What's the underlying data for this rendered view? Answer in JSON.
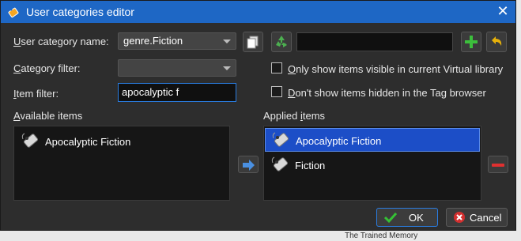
{
  "window": {
    "title": "User categories editor",
    "close_glyph": "✕"
  },
  "labels": {
    "category_name": {
      "pre": "",
      "key": "U",
      "post": "ser category name:"
    },
    "category_filter": {
      "pre": "",
      "key": "C",
      "post": "ategory filter:"
    },
    "item_filter": {
      "pre": "",
      "key": "I",
      "post": "tem filter:"
    },
    "available": {
      "pre": "",
      "key": "A",
      "post": "vailable items"
    },
    "applied": {
      "pre": "Applied ",
      "key": "i",
      "post": "tems"
    }
  },
  "fields": {
    "category_name_value": "genre.Fiction",
    "category_filter_value": "",
    "item_filter_value": "apocalyptic f",
    "new_category_value": ""
  },
  "checks": {
    "only_visible": {
      "pre": "",
      "key": "O",
      "post": "nly show items visible in current Virtual library",
      "checked": false
    },
    "dont_show_hidden": {
      "pre": "",
      "key": "D",
      "post": "on't show items hidden in the Tag browser",
      "checked": false
    }
  },
  "available_items": [
    {
      "label": "Apocalyptic Fiction"
    }
  ],
  "applied_items": [
    {
      "label": "Apocalyptic Fiction",
      "selected": true
    },
    {
      "label": "Fiction",
      "selected": false
    }
  ],
  "buttons": {
    "ok": "OK",
    "cancel": "Cancel"
  },
  "background": {
    "left": "",
    "right": "The Trained Memory"
  },
  "icons": {
    "app": "tag-icon",
    "copy": "copy-icon",
    "recycle": "recycle-icon",
    "add": "plus-icon",
    "undo": "undo-icon",
    "move": "arrow-right-icon",
    "remove": "minus-icon",
    "ok": "check-icon",
    "cancel": "cancel-icon"
  },
  "colors": {
    "titlebar": "#1e67c5",
    "selection": "#1c4ec7",
    "accent": "#2a7de1"
  }
}
